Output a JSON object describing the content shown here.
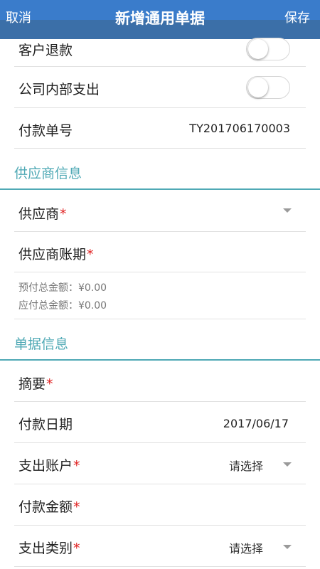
{
  "header": {
    "cancel_label": "取消",
    "title": "新增通用单据",
    "save_label": "保存"
  },
  "toggles": [
    {
      "label": "客户退款",
      "on": false
    },
    {
      "label": "公司内部支出",
      "on": false
    }
  ],
  "payment_no": {
    "label": "付款单号",
    "value": "TY201706170003"
  },
  "supplier_section": {
    "title": "供应商信息",
    "supplier_label": "供应商",
    "supplier_period_label": "供应商账期",
    "prepaid_total": "预付总金额：¥0.00",
    "payable_total": "应付总金额：¥0.00"
  },
  "document_section": {
    "title": "单据信息",
    "summary_label": "摘要",
    "payment_date_label": "付款日期",
    "payment_date_value": "2017/06/17",
    "expense_account_label": "支出账户",
    "expense_account_value": "请选择",
    "payment_amount_label": "付款金额",
    "expense_category_label": "支出类别",
    "expense_category_value": "请选择"
  },
  "required_marker": "*",
  "colors": {
    "header": "#3b6fa8",
    "section_accent": "#4fa9b5",
    "required": "#e02020"
  }
}
